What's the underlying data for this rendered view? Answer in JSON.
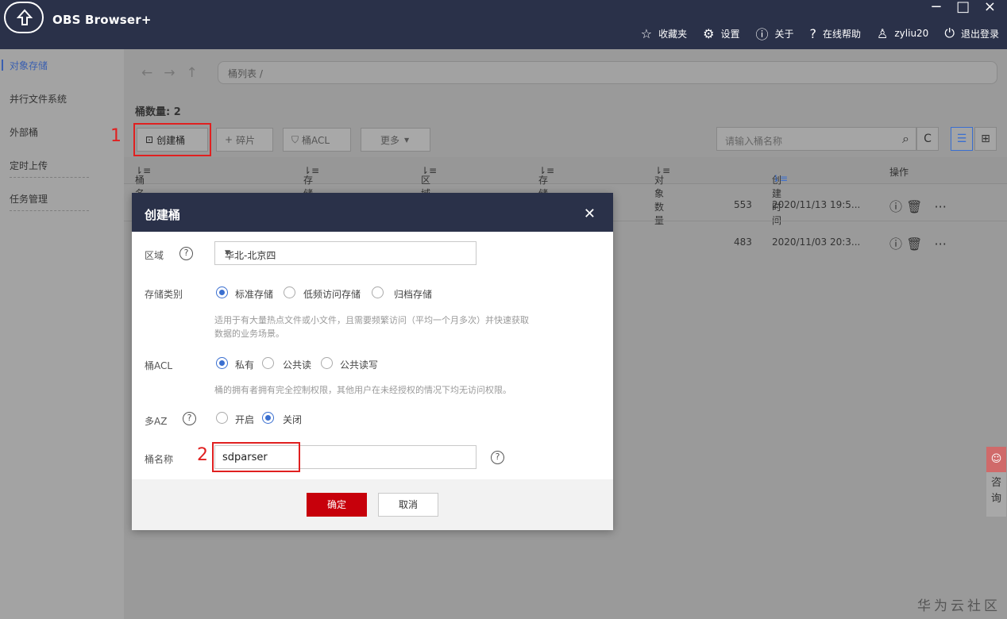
{
  "app": {
    "title": "OBS Browser+",
    "window_controls": "− □ ×"
  },
  "nav": [
    {
      "icon": "☆",
      "label": "收藏夹"
    },
    {
      "icon": "⚙",
      "label": "设置"
    },
    {
      "icon": "ⓘ",
      "label": "关于"
    },
    {
      "icon": "?",
      "label": "在线帮助"
    },
    {
      "icon": "♙",
      "label": "zyliu20"
    },
    {
      "icon": "⏻",
      "label": "退出登录"
    }
  ],
  "sidebar": {
    "items": [
      {
        "label": "对象存储",
        "active": true
      },
      {
        "label": "并行文件系统"
      },
      {
        "label": "外部桶"
      },
      {
        "label": "定时上传"
      },
      {
        "label": "任务管理"
      }
    ]
  },
  "path": "桶列表 /",
  "bucket_count": "桶数量: 2",
  "toolbar": {
    "create": "创建桶",
    "fragments": "碎片",
    "acl": "桶ACL",
    "more": "更多"
  },
  "search_placeholder": "请输入桶名称",
  "steps": {
    "one": "1",
    "two": "2"
  },
  "table": {
    "headers": [
      "桶名称",
      "存储类别",
      "区域",
      "存储用量",
      "对象数量",
      "创建时间",
      "操作"
    ],
    "rows": [
      {
        "objects": "553",
        "created": "2020/11/13 19:5..."
      },
      {
        "objects": "483",
        "created": "2020/11/03 20:3..."
      }
    ]
  },
  "dialog": {
    "title": "创建桶",
    "region_label": "区域",
    "region_value": "华北-北京四",
    "storage_label": "存储类别",
    "storage_options": [
      "标准存储",
      "低频访问存储",
      "归档存储"
    ],
    "storage_hint_1": "适用于有大量热点文件或小文件，且需要频繁访问（平均一个月多次）并快速获取",
    "storage_hint_2": "数据的业务场景。",
    "acl_label": "桶ACL",
    "acl_options": [
      "私有",
      "公共读",
      "公共读写"
    ],
    "acl_hint": "桶的拥有者拥有完全控制权限，其他用户在未经授权的情况下均无访问权限。",
    "multiaz_label": "多AZ",
    "multiaz_options": [
      "开启",
      "关闭"
    ],
    "name_label": "桶名称",
    "name_value": "sdparser",
    "ok": "确定",
    "cancel": "取消"
  },
  "consult": {
    "line1": "咨",
    "line2": "询"
  },
  "watermark": "华为云社区"
}
